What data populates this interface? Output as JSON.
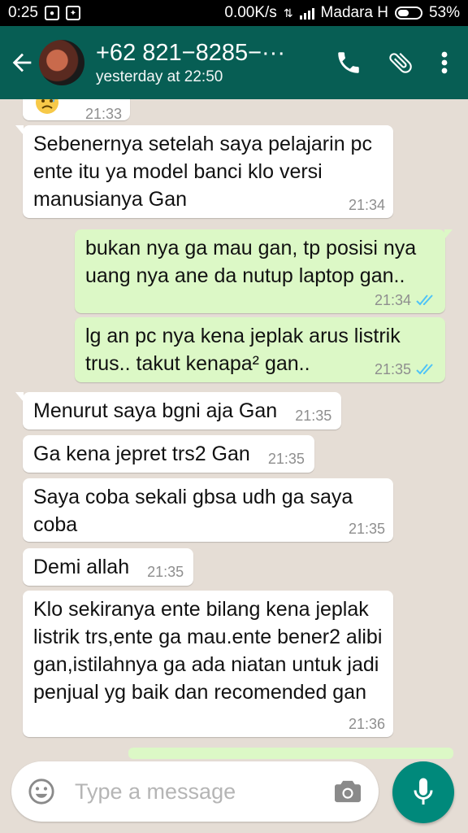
{
  "status_bar": {
    "time": "0:25",
    "speed": "0.00K/s",
    "carrier": "Madara H",
    "battery": "53%",
    "battery_level": 0.53
  },
  "header": {
    "contact_name": "+62 821−8285−···",
    "last_seen": "yesterday at 22:50",
    "icons": [
      "back-arrow-icon",
      "phone-icon",
      "paperclip-icon",
      "more-vert-icon"
    ]
  },
  "messages": [
    {
      "dir": "in",
      "text": "",
      "time": "21:33",
      "emoji": "sad-face"
    },
    {
      "dir": "in",
      "text": "Sebenernya setelah saya pelajarin pc ente itu ya model banci klo versi manusianya Gan",
      "time": "21:34"
    },
    {
      "dir": "out",
      "text": "bukan nya ga mau gan, tp posisi nya uang nya ane da nutup laptop gan..",
      "time": "21:34",
      "status": "read"
    },
    {
      "dir": "out",
      "text": "lg an pc nya kena jeplak arus listrik trus.. takut kenapa² gan..",
      "time": "21:35",
      "status": "read"
    },
    {
      "dir": "in",
      "text": "Menurut saya bgni aja Gan",
      "time": "21:35"
    },
    {
      "dir": "in",
      "text": "Ga kena jepret trs2 Gan",
      "time": "21:35"
    },
    {
      "dir": "in",
      "text": "Saya coba sekali gbsa udh ga saya coba",
      "time": "21:35"
    },
    {
      "dir": "in",
      "text": "Demi allah",
      "time": "21:35"
    },
    {
      "dir": "in",
      "text": "Klo sekiranya ente bilang kena jeplak listrik trs,ente ga mau.ente bener2 alibi gan,istilahnya ga ada niatan untuk jadi penjual yg baik dan recomended gan",
      "time": "21:36"
    }
  ],
  "composer": {
    "placeholder": "Type a message"
  },
  "colors": {
    "header": "#075e54",
    "outgoing_bubble": "#dcf8c6",
    "incoming_bubble": "#ffffff",
    "chat_bg": "#e5ddd5",
    "read_tick": "#4fc3f7",
    "mic_button": "#00897b"
  }
}
